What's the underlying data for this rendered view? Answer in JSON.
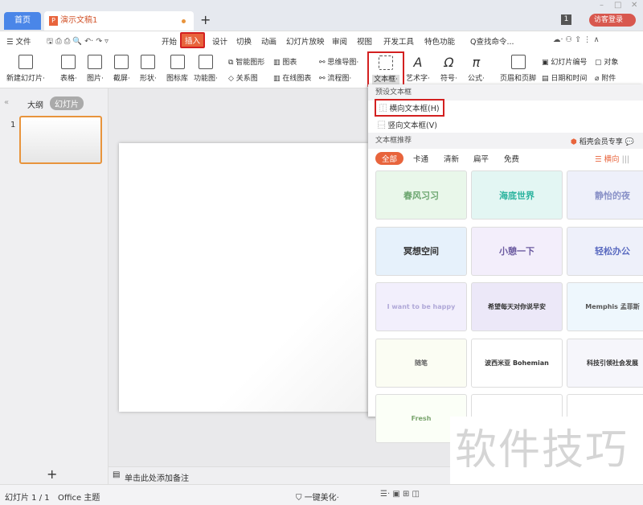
{
  "tabs": {
    "home": "首页",
    "doc": "演示文稿1",
    "new": "+"
  },
  "titlebar": {
    "badge": "1",
    "login": "访客登录",
    "win": [
      "–",
      "□",
      "✕"
    ]
  },
  "menu": {
    "file": "☰ 文件",
    "items": [
      "开始",
      "插入",
      "设计",
      "切换",
      "动画",
      "幻灯片放映",
      "审阅",
      "视图",
      "开发工具",
      "特色功能"
    ],
    "search": "Q查找命令..."
  },
  "ribbon": {
    "big": [
      "新建幻灯片·",
      "表格·",
      "图片·",
      "截屏·",
      "形状·",
      "图标库",
      "功能图·"
    ],
    "small": [
      "智能图形",
      "关系图",
      "图表",
      "在线图表",
      "思维导图·",
      "流程图·"
    ],
    "textbox": "文本框·",
    "big2": [
      "艺术字·",
      "符号·",
      "公式·",
      "页眉和页脚"
    ],
    "small2": [
      "幻灯片编号",
      "对象",
      "日期和时间",
      "附件"
    ]
  },
  "left": {
    "tabs": [
      "大纲",
      "幻灯片"
    ],
    "slide_num": "1",
    "add": "+"
  },
  "notes": "单击此处添加备注",
  "status": {
    "slide": "幻灯片 1 / 1",
    "theme": "Office 主题",
    "beautify": "一键美化·"
  },
  "dropdown": {
    "preset_title": "预设文本框",
    "horizontal": "横向文本框(H)",
    "vertical": "竖向文本框(V)",
    "rec_title": "文本框推荐",
    "vip": "稻壳会员专享",
    "filters": [
      "全部",
      "卡通",
      "清新",
      "扁平",
      "免费"
    ],
    "orient": "横向",
    "cards": [
      "春风习习",
      "海底世界",
      "静怡的夜",
      "冥想空间",
      "小憩一下",
      "轻松办公",
      "I want to be happy",
      "希望每天对你说早安",
      "Memphis 孟菲斯",
      "随笔",
      "波西米亚 Bohemian",
      "科技引领社会发展",
      "Fresh",
      "",
      ""
    ]
  },
  "watermark": "软件技巧",
  "colors": {
    "accent": "#e8643c",
    "highlight": "#d32020",
    "home_tab": "#4a86e8"
  }
}
